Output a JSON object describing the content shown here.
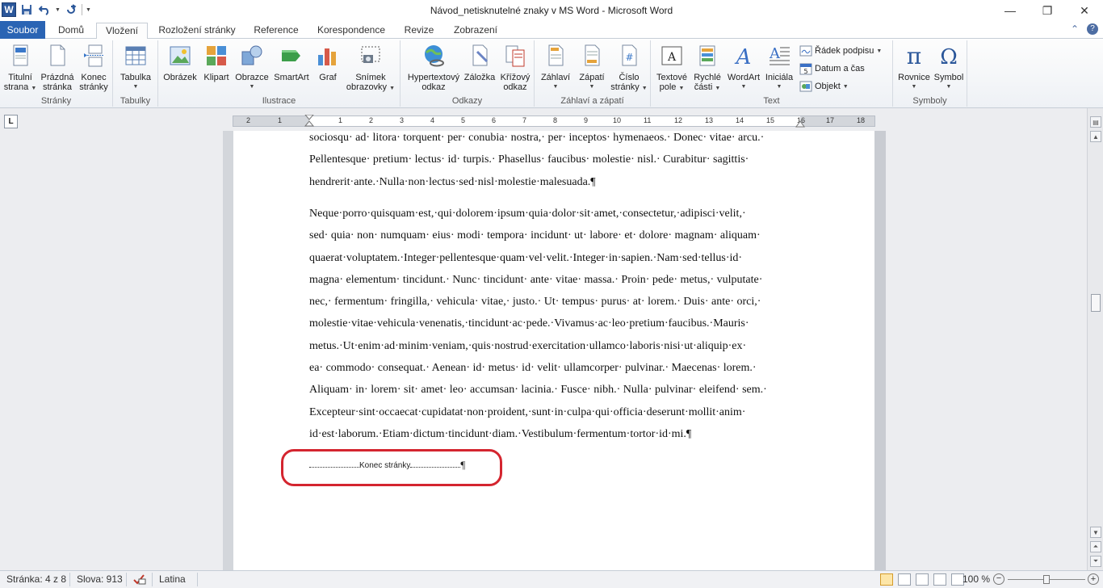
{
  "window": {
    "title": "Návod_netisknutelné znaky v MS Word - Microsoft Word"
  },
  "tabs": {
    "file": "Soubor",
    "items": [
      "Domů",
      "Vložení",
      "Rozložení stránky",
      "Reference",
      "Korespondence",
      "Revize",
      "Zobrazení"
    ],
    "active": "Vložení"
  },
  "ribbon": {
    "groups": {
      "stranky": "Stránky",
      "tabulky": "Tabulky",
      "ilustrace": "Ilustrace",
      "odkazy": "Odkazy",
      "zahlavi": "Záhlaví a zápatí",
      "text": "Text",
      "symboly": "Symboly"
    },
    "buttons": {
      "titulni_1": "Titulní",
      "titulni_2": "strana",
      "prazdna_1": "Prázdná",
      "prazdna_2": "stránka",
      "konec_1": "Konec",
      "konec_2": "stránky",
      "tabulka": "Tabulka",
      "obrazek": "Obrázek",
      "klipart": "Klipart",
      "obrazce": "Obrazce",
      "smartart": "SmartArt",
      "graf": "Graf",
      "snimek_1": "Snímek",
      "snimek_2": "obrazovky",
      "hypertext_1": "Hypertextový",
      "hypertext_2": "odkaz",
      "zalozka": "Záložka",
      "krizovy_1": "Křížový",
      "krizovy_2": "odkaz",
      "zahlavi": "Záhlaví",
      "zapati": "Zápatí",
      "cislo_1": "Číslo",
      "cislo_2": "stránky",
      "textove_1": "Textové",
      "textove_2": "pole",
      "rychle_1": "Rychlé",
      "rychle_2": "části",
      "wordart": "WordArt",
      "iniciala": "Iniciála",
      "radek_podpisu": "Řádek podpisu",
      "datum_cas": "Datum a čas",
      "objekt": "Objekt",
      "rovnice": "Rovnice",
      "symbol": "Symbol"
    }
  },
  "ruler": {
    "left_labels": [
      "2",
      "1"
    ],
    "right_labels": [
      "1",
      "2",
      "3",
      "4",
      "5",
      "6",
      "7",
      "8",
      "9",
      "10",
      "11",
      "12",
      "13",
      "14",
      "15",
      "16",
      "17",
      "18"
    ]
  },
  "document": {
    "para1_lines": [
      "sociosqu· ad· litora· torquent· per· conubia· nostra,· per· inceptos· hymenaeos.· Donec· vitae· arcu.·",
      "Pellentesque· pretium· lectus· id· turpis.· Phasellus· faucibus· molestie· nisl.· Curabitur· sagittis·",
      "hendrerit·ante.·Nulla·non·lectus·sed·nisl·molestie·malesuada.¶"
    ],
    "para2_lines": [
      "Neque·porro·quisquam·est,·qui·dolorem·ipsum·quia·dolor·sit·amet,·consectetur,·adipisci·velit,·",
      "sed· quia· non· numquam· eius· modi· tempora· incidunt· ut· labore· et· dolore· magnam· aliquam·",
      "quaerat·voluptatem.·Integer·pellentesque·quam·vel·velit.·Integer·in·sapien.·Nam·sed·tellus·id·",
      "magna· elementum· tincidunt.· Nunc· tincidunt· ante· vitae· massa.· Proin· pede· metus,· vulputate·",
      "nec,· fermentum· fringilla,· vehicula· vitae,· justo.· Ut· tempus· purus· at· lorem.· Duis· ante· orci,·",
      "molestie·vitae·vehicula·venenatis,·tincidunt·ac·pede.·Vivamus·ac·leo·pretium·faucibus.·Mauris·",
      "metus.·Ut·enim·ad·minim·veniam,·quis·nostrud·exercitation·ullamco·laboris·nisi·ut·aliquip·ex·",
      "ea· commodo· consequat.· Aenean· id· metus· id· velit· ullamcorper· pulvinar.· Maecenas· lorem.·",
      "Aliquam· in· lorem· sit· amet· leo· accumsan· lacinia.· Fusce· nibh.· Nulla· pulvinar· eleifend· sem.·",
      "Excepteur·sint·occaecat·cupidatat·non·proident,·sunt·in·culpa·qui·officia·deserunt·mollit·anim·",
      "id·est·laborum.·Etiam·dictum·tincidunt·diam.·Vestibulum·fermentum·tortor·id·mi.¶"
    ],
    "page_break_label": "Konec stránky",
    "page_break_mark": "¶"
  },
  "status": {
    "page": "Stránka: 4 z 8",
    "words": "Slova: 913",
    "language": "Latina",
    "zoom": "100 %"
  },
  "colors": {
    "file_tab": "#2a64b4",
    "highlight": "#d4252f"
  }
}
